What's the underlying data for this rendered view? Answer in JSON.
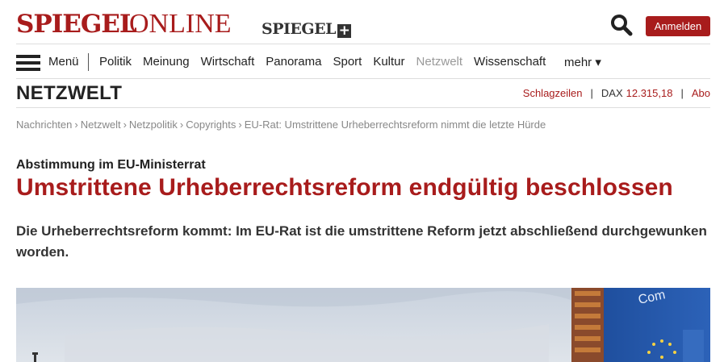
{
  "header": {
    "logo_spiegel": "SPIEGEL",
    "logo_online": "ONLINE",
    "logo_plus": "SPIEGEL",
    "plus_symbol": "+",
    "login_label": "Anmelden",
    "brand_color": "#a81c1c"
  },
  "nav": {
    "menu_label": "Menü",
    "items": [
      {
        "label": "Politik"
      },
      {
        "label": "Meinung"
      },
      {
        "label": "Wirtschaft"
      },
      {
        "label": "Panorama"
      },
      {
        "label": "Sport"
      },
      {
        "label": "Kultur"
      },
      {
        "label": "Netzwelt"
      },
      {
        "label": "Wissenschaft"
      }
    ],
    "more_label": "mehr ▾"
  },
  "section": {
    "title": "NETZWELT",
    "headlines_label": "Schlagzeilen",
    "dax_label": "DAX",
    "dax_value": "12.315,18",
    "abo_label": "Abo"
  },
  "breadcrumb": {
    "items": [
      "Nachrichten",
      "Netzwelt",
      "Netzpolitik",
      "Copyrights"
    ],
    "current": "EU-Rat: Umstrittene Urheberrechtsreform nimmt die letzte Hürde"
  },
  "article": {
    "kicker": "Abstimmung im EU-Ministerrat",
    "headline": "Umstrittene Urheberrechtsreform endgültig beschlossen",
    "teaser": "Die Urheberrechtsreform kommt: Im EU-Rat ist die umstrittene Reform jetzt abschließend durchgewunken worden."
  }
}
